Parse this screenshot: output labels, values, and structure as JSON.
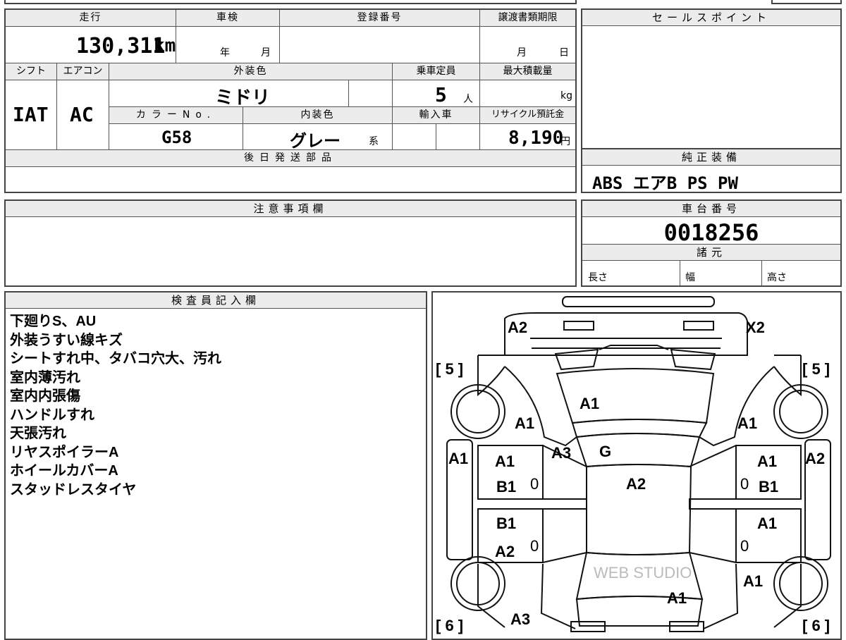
{
  "top_table": {
    "mileage_label": "走行",
    "mileage_value": "130,311",
    "mileage_unit": "km",
    "inspection_label": "車検",
    "inspection_year": "年",
    "inspection_month": "月",
    "registration_label": "登録番号",
    "transfer_label": "譲渡書類期限",
    "transfer_month": "月",
    "transfer_day": "日",
    "shift_label": "シフト",
    "shift_value": "IAT",
    "ac_label": "エアコン",
    "ac_value": "AC",
    "exterior_label": "外装色",
    "exterior_value": "ミドリ",
    "capacity_label": "乗車定員",
    "capacity_value": "5",
    "capacity_unit": "人",
    "load_label": "最大積載量",
    "load_unit": "kg",
    "color_no_label": "カラーNo.",
    "color_no_value": "G58",
    "interior_label": "内装色",
    "interior_value": "グレー",
    "interior_suffix": "系",
    "import_label": "輸入車",
    "recycle_label": "リサイクル預託金",
    "recycle_value": "8,190",
    "recycle_unit": "円",
    "later_parts_label": "後日発送部品"
  },
  "sales_point": {
    "label": "セールスポイント"
  },
  "genuine_equipment": {
    "label": "純正装備",
    "value": "ABS エアB PS PW"
  },
  "notes_section": {
    "label": "注意事項欄"
  },
  "chassis": {
    "label": "車台番号",
    "value": "0018256",
    "specs_label": "諸元",
    "length_label": "長さ",
    "width_label": "幅",
    "height_label": "高さ"
  },
  "inspector": {
    "label": "検査員記入欄",
    "lines": [
      "下廻りS、AU",
      "外装うすい線キズ",
      "シートすれ中、タバコ穴大、汚れ",
      "室内薄汚れ",
      "室内内張傷",
      "ハンドルすれ",
      "天張汚れ",
      "リヤスポイラーA",
      "ホイールカバーA",
      "スタッドレスタイヤ"
    ]
  },
  "diagram": {
    "marks": {
      "front_left": "A2",
      "front_right": "X2",
      "tire_fl": "[ 5 ]",
      "tire_fr": "[ 5 ]",
      "tire_rl": "[ 6 ]",
      "tire_rr": "[ 6 ]",
      "hood": "A1",
      "fender_l": "A1",
      "fender_r": "A1",
      "pillar_l": "A3",
      "windshield": "G",
      "roof": "A2",
      "side_l": "A1",
      "side_r": "A2",
      "door_fl_1": "A1",
      "door_fl_2": "B1",
      "door_fr_1": "A1",
      "door_fr_2": "B1",
      "door_rl_1": "B1",
      "door_rl_2": "A2",
      "door_rr_1": "A1",
      "quarter_r": "A1",
      "trunk": "A1",
      "rear_l": "A3",
      "zero": "0"
    },
    "watermark": "WEB STUDIO"
  }
}
